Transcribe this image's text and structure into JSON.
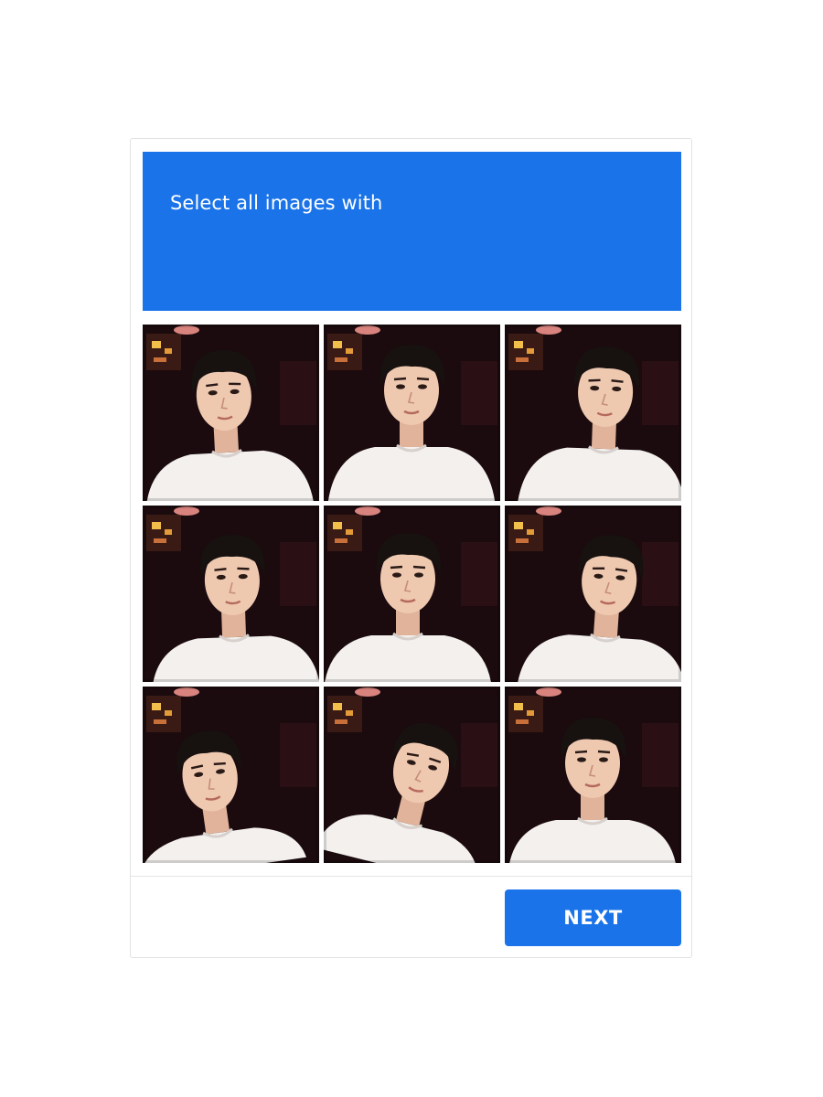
{
  "challenge": {
    "prompt": "Select all images with",
    "header_color": "#1a73e8"
  },
  "tiles": [
    {
      "subject": "selfie-young-man-white-tshirt",
      "selected": false
    },
    {
      "subject": "selfie-young-man-white-tshirt",
      "selected": false
    },
    {
      "subject": "selfie-young-man-white-tshirt",
      "selected": false
    },
    {
      "subject": "selfie-young-man-white-tshirt",
      "selected": false
    },
    {
      "subject": "selfie-young-man-white-tshirt",
      "selected": false
    },
    {
      "subject": "selfie-young-man-white-tshirt",
      "selected": false
    },
    {
      "subject": "selfie-young-man-white-tshirt",
      "selected": false
    },
    {
      "subject": "selfie-young-man-white-tshirt",
      "selected": false
    },
    {
      "subject": "selfie-young-man-white-tshirt",
      "selected": false
    }
  ],
  "footer": {
    "next_label": "NEXT",
    "button_color": "#1a73e8"
  }
}
